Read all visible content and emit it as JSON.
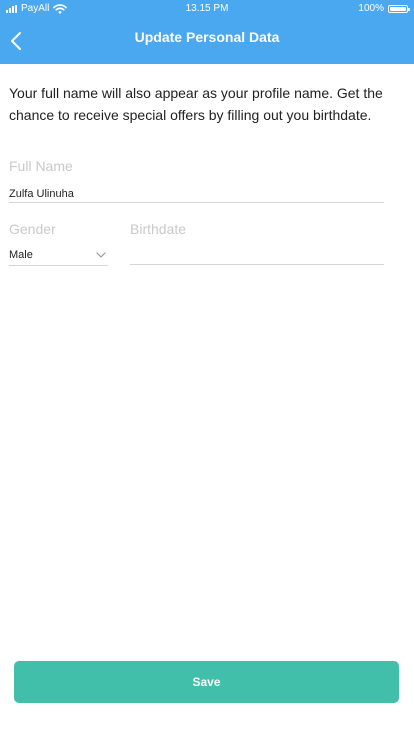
{
  "status_bar": {
    "carrier": "PayAll",
    "time": "13.15 PM",
    "battery": "100%"
  },
  "header": {
    "title": "Update Personal Data",
    "back_icon": "chevron-left-icon",
    "background_color": "#4aa8f0"
  },
  "intro_text": "Your full name will also appear as your profile name. Get the chance to receive special offers by filling out you birthdate.",
  "form": {
    "full_name": {
      "label": "Full Name",
      "value": "Zulfa Ulinuha"
    },
    "gender": {
      "label": "Gender",
      "value": "Male"
    },
    "birthdate": {
      "label": "Birthdate",
      "value": ""
    }
  },
  "save_button": {
    "label": "Save",
    "color": "#42bfaa"
  }
}
